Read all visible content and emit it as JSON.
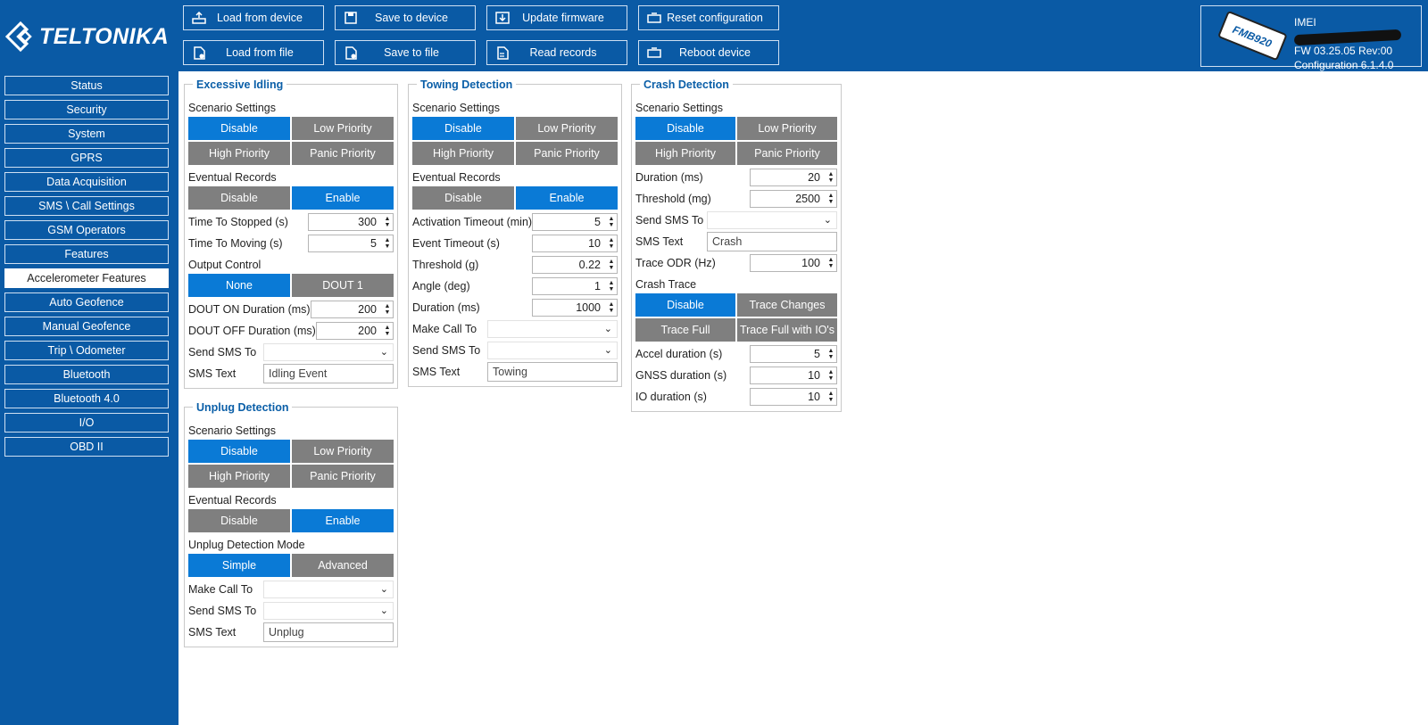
{
  "brand": {
    "name": "TELTONIKA"
  },
  "toolbar": {
    "load_device": "Load from device",
    "save_device": "Save to device",
    "update_fw": "Update firmware",
    "reset_cfg": "Reset configuration",
    "load_file": "Load from file",
    "save_file": "Save to file",
    "read_records": "Read records",
    "reboot": "Reboot device"
  },
  "device": {
    "model": "FMB920",
    "imei_label": "IMEI",
    "fw": "FW  03.25.05 Rev:00",
    "config": "Configuration  6.1.4.0"
  },
  "sidebar": {
    "items": [
      "Status",
      "Security",
      "System",
      "GPRS",
      "Data Acquisition",
      "SMS \\ Call Settings",
      "GSM Operators",
      "Features",
      "Accelerometer Features",
      "Auto Geofence",
      "Manual Geofence",
      "Trip \\ Odometer",
      "Bluetooth",
      "Bluetooth 4.0",
      "I/O",
      "OBD II"
    ],
    "active": "Accelerometer Features"
  },
  "common": {
    "scenario_settings": "Scenario Settings",
    "eventual_records": "Eventual Records",
    "disable": "Disable",
    "enable": "Enable",
    "low": "Low Priority",
    "high": "High Priority",
    "panic": "Panic Priority",
    "send_sms_to": "Send SMS To",
    "make_call_to": "Make Call To",
    "sms_text": "SMS Text"
  },
  "idling": {
    "title": "Excessive Idling",
    "time_stopped_label": "Time To Stopped (s)",
    "time_stopped": "300",
    "time_moving_label": "Time To Moving (s)",
    "time_moving": "5",
    "output_control": "Output Control",
    "none": "None",
    "dout1": "DOUT 1",
    "dout_on_label": "DOUT ON Duration (ms)",
    "dout_on": "200",
    "dout_off_label": "DOUT OFF Duration (ms)",
    "dout_off": "200",
    "sms_text": "Idling Event"
  },
  "unplug": {
    "title": "Unplug Detection",
    "mode_label": "Unplug Detection Mode",
    "simple": "Simple",
    "advanced": "Advanced",
    "sms_text": "Unplug"
  },
  "towing": {
    "title": "Towing Detection",
    "activation_label": "Activation Timeout (min)",
    "activation": "5",
    "event_timeout_label": "Event Timeout (s)",
    "event_timeout": "10",
    "threshold_label": "Threshold (g)",
    "threshold": "0.22",
    "angle_label": "Angle (deg)",
    "angle": "1",
    "duration_label": "Duration (ms)",
    "duration": "1000",
    "sms_text": "Towing"
  },
  "crash": {
    "title": "Crash Detection",
    "duration_label": "Duration (ms)",
    "duration": "20",
    "threshold_label": "Threshold (mg)",
    "threshold": "2500",
    "sms_text": "Crash",
    "trace_odr_label": "Trace ODR (Hz)",
    "trace_odr": "100",
    "crash_trace": "Crash Trace",
    "trace_changes": "Trace Changes",
    "trace_full": "Trace Full",
    "trace_full_io": "Trace Full with IO's",
    "accel_label": "Accel duration (s)",
    "accel": "5",
    "gnss_label": "GNSS duration (s)",
    "gnss": "10",
    "io_label": "IO duration (s)",
    "io": "10"
  },
  "colors": {
    "brand_blue": "#0a5aa5",
    "selected": "#0a7ad6",
    "unselected": "#7f7f7f"
  }
}
